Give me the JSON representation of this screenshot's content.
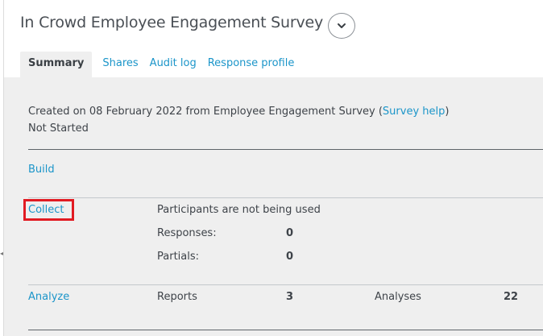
{
  "header": {
    "title": "In Crowd Employee Engagement Survey",
    "toggle_icon": "chevron-down-icon"
  },
  "tabs": [
    {
      "label": "Summary",
      "active": true
    },
    {
      "label": "Shares",
      "active": false
    },
    {
      "label": "Audit log",
      "active": false
    },
    {
      "label": "Response profile",
      "active": false
    }
  ],
  "summary": {
    "created_prefix": "Created on 08 February 2022 from Employee Engagement Survey (",
    "survey_help": "Survey help",
    "created_suffix": ")",
    "status": "Not Started"
  },
  "build": {
    "label": "Build"
  },
  "collect": {
    "label": "Collect",
    "participants_text": "Participants are not being used",
    "responses_label": "Responses:",
    "responses_value": "0",
    "partials_label": "Partials:",
    "partials_value": "0"
  },
  "analyze": {
    "label": "Analyze",
    "reports_label": "Reports",
    "reports_value": "3",
    "analyses_label": "Analyses",
    "analyses_value": "22"
  },
  "colors": {
    "link": "#1b95c9",
    "highlight": "#e11b22",
    "panel_bg": "#efefef"
  }
}
